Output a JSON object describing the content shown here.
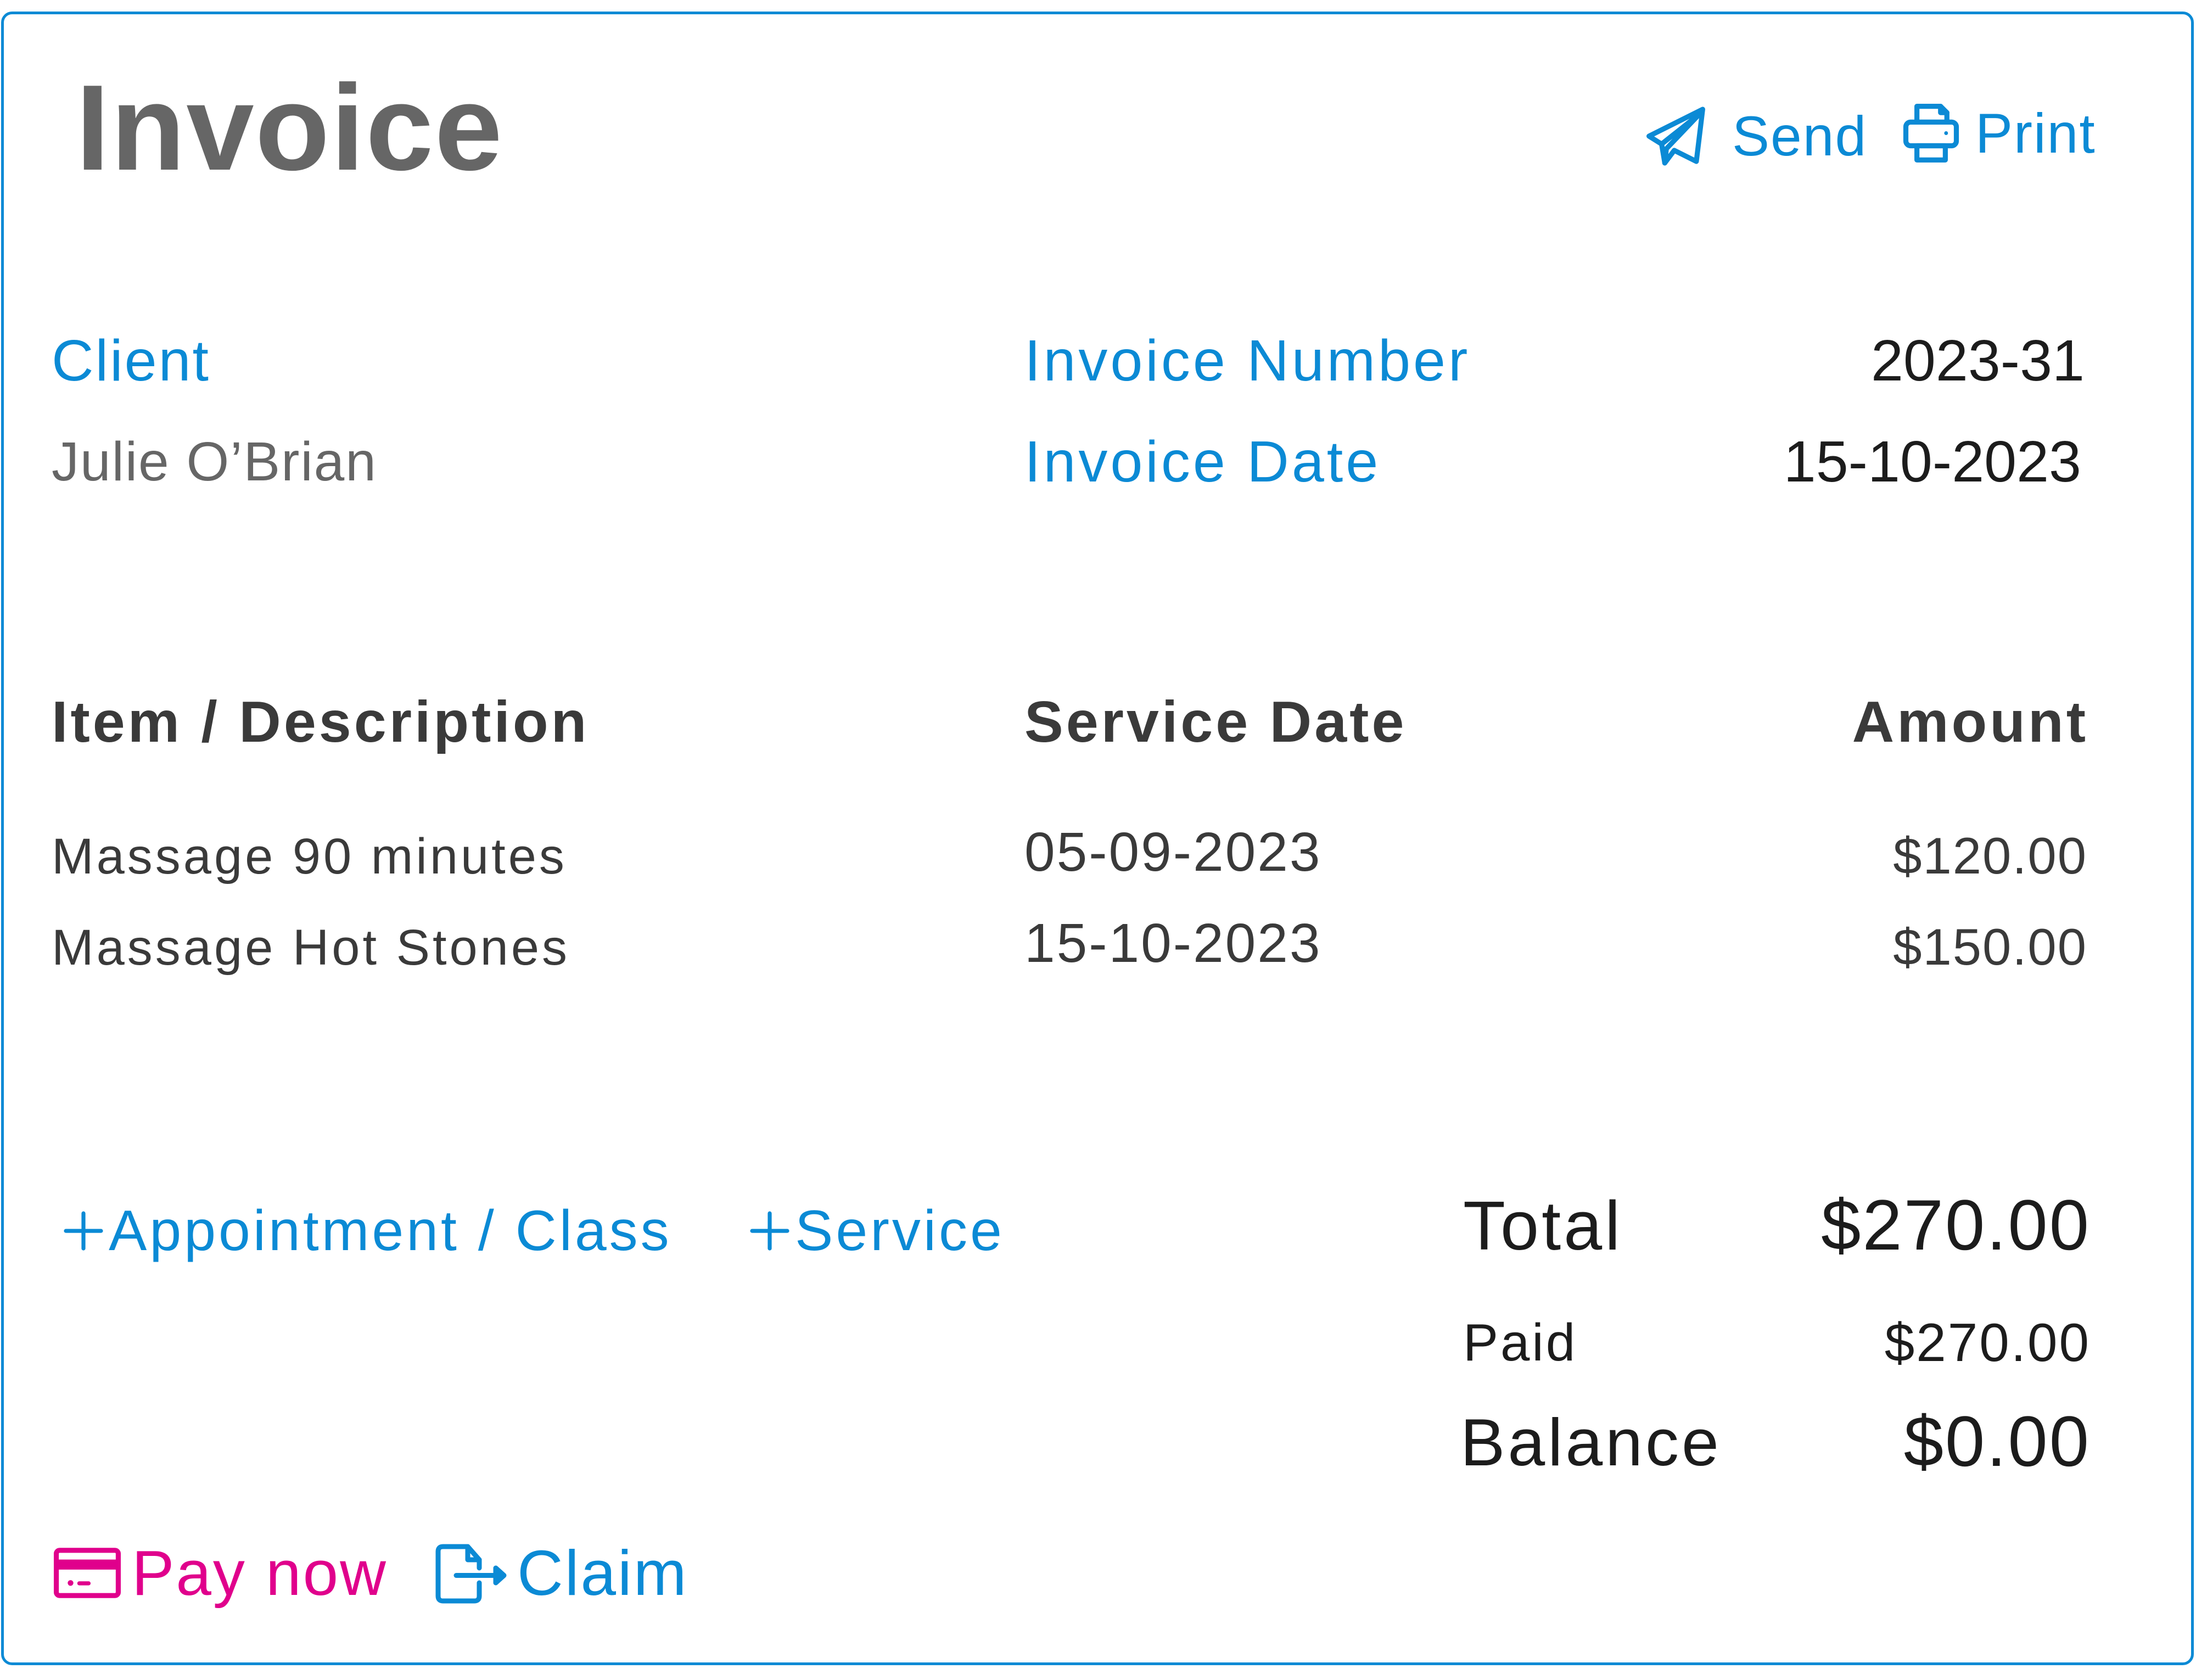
{
  "header": {
    "title": "Invoice",
    "actions": [
      {
        "label": "Send",
        "icon": "paper-plane-icon"
      },
      {
        "label": "Print",
        "icon": "printer-icon"
      }
    ]
  },
  "meta": {
    "client_label": "Client",
    "client_name": "Julie O’Brian",
    "invoice_number_label": "Invoice Number",
    "invoice_number": "2023-31",
    "invoice_date_label": "Invoice Date",
    "invoice_date": "15-10-2023"
  },
  "table": {
    "columns": [
      "Item / Description",
      "Service Date",
      "Amount"
    ],
    "rows": [
      {
        "description": "Massage 90 minutes",
        "service_date": "05-09-2023",
        "amount": "$120.00"
      },
      {
        "description": "Massage Hot Stones",
        "service_date": "15-10-2023",
        "amount": "$150.00"
      }
    ]
  },
  "add_actions": [
    {
      "label": "Appointment / Class",
      "icon": "plus-icon"
    },
    {
      "label": "Service",
      "icon": "plus-icon"
    }
  ],
  "totals": {
    "total_label": "Total",
    "total": "$270.00",
    "paid_label": "Paid",
    "paid": "$270.00",
    "balance_label": "Balance",
    "balance": "$0.00"
  },
  "footer_actions": [
    {
      "label": "Pay now",
      "icon": "credit-card-icon"
    },
    {
      "label": "Claim",
      "icon": "file-export-icon"
    }
  ],
  "colors": {
    "accent": "#0B8AD5",
    "pay": "#E0008C",
    "text_muted": "#666666",
    "text_dark": "#3a3a3a",
    "text_strong": "#1c1c1c"
  }
}
